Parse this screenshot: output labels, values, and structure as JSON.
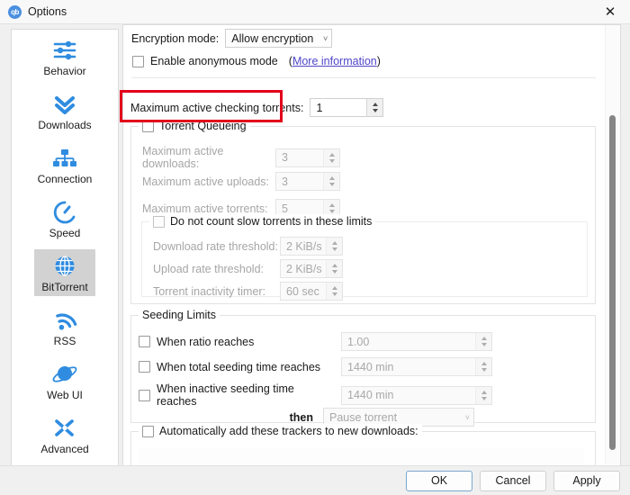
{
  "window": {
    "title": "Options",
    "app_icon": "qb",
    "close_icon": "close-icon"
  },
  "sidebar": {
    "items": [
      {
        "label": "Behavior",
        "icon": "sliders-icon",
        "selected": false
      },
      {
        "label": "Downloads",
        "icon": "chevrons-down-icon",
        "selected": false
      },
      {
        "label": "Connection",
        "icon": "network-icon",
        "selected": false
      },
      {
        "label": "Speed",
        "icon": "speedometer-icon",
        "selected": false
      },
      {
        "label": "BitTorrent",
        "icon": "globe-icon",
        "selected": true
      },
      {
        "label": "RSS",
        "icon": "rss-icon",
        "selected": false
      },
      {
        "label": "Web UI",
        "icon": "planet-icon",
        "selected": false
      },
      {
        "label": "Advanced",
        "icon": "wrench-icon",
        "selected": false
      }
    ]
  },
  "encryption": {
    "mode_label": "Encryption mode:",
    "mode_value": "Allow encryption",
    "anonymous_label": "Enable anonymous mode",
    "anonymous_checked": false,
    "more_info_open": "(",
    "more_info_link": "More information",
    "more_info_close": ")"
  },
  "checking": {
    "label": "Maximum active checking torrents:",
    "value": "1"
  },
  "queueing": {
    "title": "Torrent Queueing",
    "checked": false,
    "highlighted": true,
    "rows": [
      {
        "label": "Maximum active downloads:",
        "value": "3"
      },
      {
        "label": "Maximum active uploads:",
        "value": "3"
      },
      {
        "label": "Maximum active torrents:",
        "value": "5"
      }
    ],
    "slow": {
      "title": "Do not count slow torrents in these limits",
      "checked": false,
      "rows": [
        {
          "label": "Download rate threshold:",
          "value": "2 KiB/s"
        },
        {
          "label": "Upload rate threshold:",
          "value": "2 KiB/s"
        },
        {
          "label": "Torrent inactivity timer:",
          "value": "60 sec"
        }
      ]
    }
  },
  "seeding": {
    "title": "Seeding Limits",
    "rows": [
      {
        "label": "When ratio reaches",
        "value": "1.00",
        "checked": false
      },
      {
        "label": "When total seeding time reaches",
        "value": "1440 min",
        "checked": false
      },
      {
        "label": "When inactive seeding time reaches",
        "value": "1440 min",
        "checked": false
      }
    ],
    "then_label": "then",
    "then_value": "Pause torrent"
  },
  "trackers": {
    "title": "Automatically add these trackers to new downloads:",
    "checked": false,
    "text": ""
  },
  "buttons": {
    "ok": "OK",
    "cancel": "Cancel",
    "apply": "Apply"
  },
  "colors": {
    "accent": "#2f8ce0",
    "highlight": "#e2001a",
    "link": "#4f46c9",
    "selection": "#d2d2d2"
  }
}
